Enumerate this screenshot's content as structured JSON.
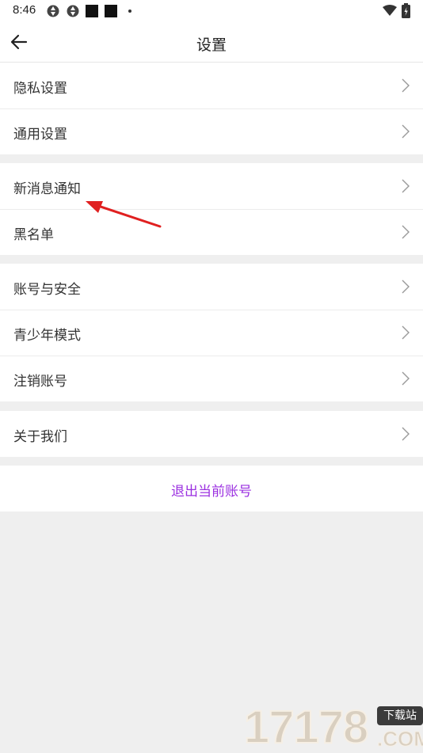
{
  "status_bar": {
    "time": "8:46",
    "icons": [
      "sync-icon",
      "sync-icon",
      "app-square-icon",
      "app-square-icon",
      "dot-icon",
      "wifi-icon",
      "battery-charging-icon"
    ]
  },
  "nav": {
    "title": "设置",
    "back_icon": "arrow-left-icon"
  },
  "groups": [
    {
      "items": [
        {
          "label": "隐私设置"
        },
        {
          "label": "通用设置"
        }
      ]
    },
    {
      "items": [
        {
          "label": "新消息通知"
        },
        {
          "label": "黑名单"
        }
      ]
    },
    {
      "items": [
        {
          "label": "账号与安全"
        },
        {
          "label": "青少年模式"
        },
        {
          "label": "注销账号"
        }
      ]
    },
    {
      "items": [
        {
          "label": "关于我们"
        }
      ]
    }
  ],
  "logout": {
    "label": "退出当前账号",
    "color": "#9b30e0"
  },
  "annotation": {
    "color": "#e02020"
  },
  "watermark": {
    "digits": "17178",
    "badge": "下载站",
    "suffix": ".COM"
  },
  "colors": {
    "background": "#efefef",
    "surface": "#ffffff",
    "text": "#333333",
    "chevron": "#9a9a9a"
  }
}
